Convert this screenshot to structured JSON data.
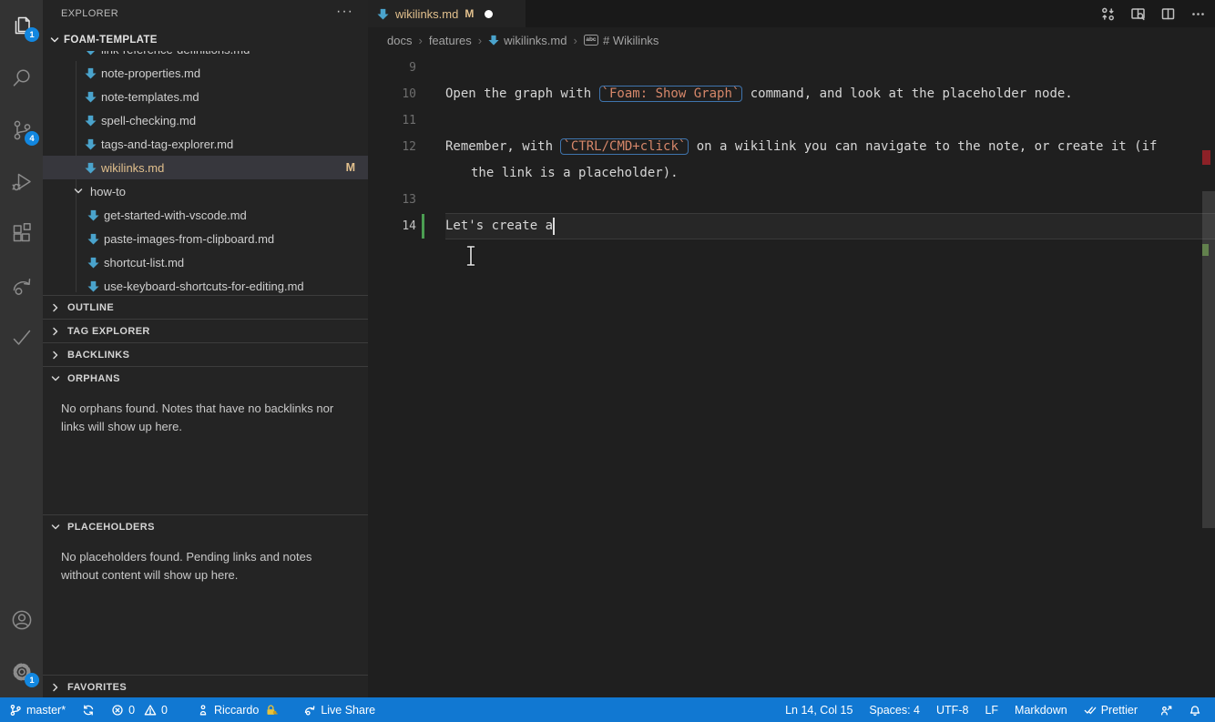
{
  "colors": {
    "statusbar_blue": "#1178d2",
    "badge_blue": "#1287e0",
    "modified_gold": "#e2c08d",
    "markdown_icon_blue": "#4aa3cc",
    "inline_code_orange": "#d6876a",
    "inline_code_border": "#3f74ad",
    "gutter_modified_green": "#4b9e52"
  },
  "activity_bar": {
    "items": [
      {
        "name": "explorer",
        "badge": "1",
        "active": true
      },
      {
        "name": "search"
      },
      {
        "name": "source-control",
        "badge": "4"
      },
      {
        "name": "run-and-debug"
      },
      {
        "name": "extensions"
      },
      {
        "name": "live-share"
      },
      {
        "name": "checklist"
      }
    ],
    "bottom": [
      {
        "name": "accounts"
      },
      {
        "name": "settings",
        "badge": "1"
      }
    ]
  },
  "sidebar": {
    "title": "EXPLORER",
    "workspace": "FOAM-TEMPLATE",
    "tree": {
      "rows": [
        {
          "name": "link-reference-definitions.md",
          "type": "file"
        },
        {
          "name": "note-properties.md",
          "type": "file"
        },
        {
          "name": "note-templates.md",
          "type": "file"
        },
        {
          "name": "spell-checking.md",
          "type": "file"
        },
        {
          "name": "tags-and-tag-explorer.md",
          "type": "file"
        },
        {
          "name": "wikilinks.md",
          "type": "file",
          "selected": true,
          "git_status": "M"
        },
        {
          "name": "how-to",
          "type": "folder",
          "expanded": true
        },
        {
          "name": "get-started-with-vscode.md",
          "type": "file",
          "child": true
        },
        {
          "name": "paste-images-from-clipboard.md",
          "type": "file",
          "child": true
        },
        {
          "name": "shortcut-list.md",
          "type": "file",
          "child": true
        },
        {
          "name": "use-keyboard-shortcuts-for-editing.md",
          "type": "file",
          "child": true
        }
      ]
    },
    "sections": [
      {
        "label": "OUTLINE",
        "collapsed": true
      },
      {
        "label": "TAG EXPLORER",
        "collapsed": true
      },
      {
        "label": "BACKLINKS",
        "collapsed": true
      },
      {
        "label": "ORPHANS",
        "collapsed": false
      },
      {
        "label": "PLACEHOLDERS",
        "collapsed": false
      },
      {
        "label": "FAVORITES",
        "collapsed": true
      }
    ],
    "orphans_message": "No orphans found. Notes that have no backlinks nor links will show up here.",
    "placeholders_message": "No placeholders found. Pending links and notes without content will show up here."
  },
  "editor": {
    "tab": {
      "name": "wikilinks.md",
      "git_status": "M",
      "dirty": true
    },
    "breadcrumbs": [
      {
        "label": "docs"
      },
      {
        "label": "features"
      },
      {
        "label": "wikilinks.md",
        "icon": "markdown"
      },
      {
        "label": "# Wikilinks",
        "icon": "symbol-string",
        "icon_label": "abc"
      }
    ],
    "lines": [
      {
        "num": "9"
      },
      {
        "num": "10",
        "pre": "Open the graph with ",
        "code": "`Foam: Show Graph`",
        "post": " command, and look at the placeholder node."
      },
      {
        "num": "11"
      },
      {
        "num": "12",
        "pre": "Remember, with ",
        "code": "`CTRL/CMD+click`",
        "post": " on a wikilink you can navigate to the note, or create it (if",
        "wrap": "the link is a placeholder)."
      },
      {
        "num": "13"
      },
      {
        "num": "14",
        "pre": "Let's create a"
      }
    ]
  },
  "status_bar": {
    "branch": "master*",
    "errors": "0",
    "warnings": "0",
    "user": "Riccardo",
    "live_share": "Live Share",
    "cursor_position": "Ln 14, Col 15",
    "indentation": "Spaces: 4",
    "encoding": "UTF-8",
    "eol": "LF",
    "language": "Markdown",
    "formatter": "Prettier"
  }
}
